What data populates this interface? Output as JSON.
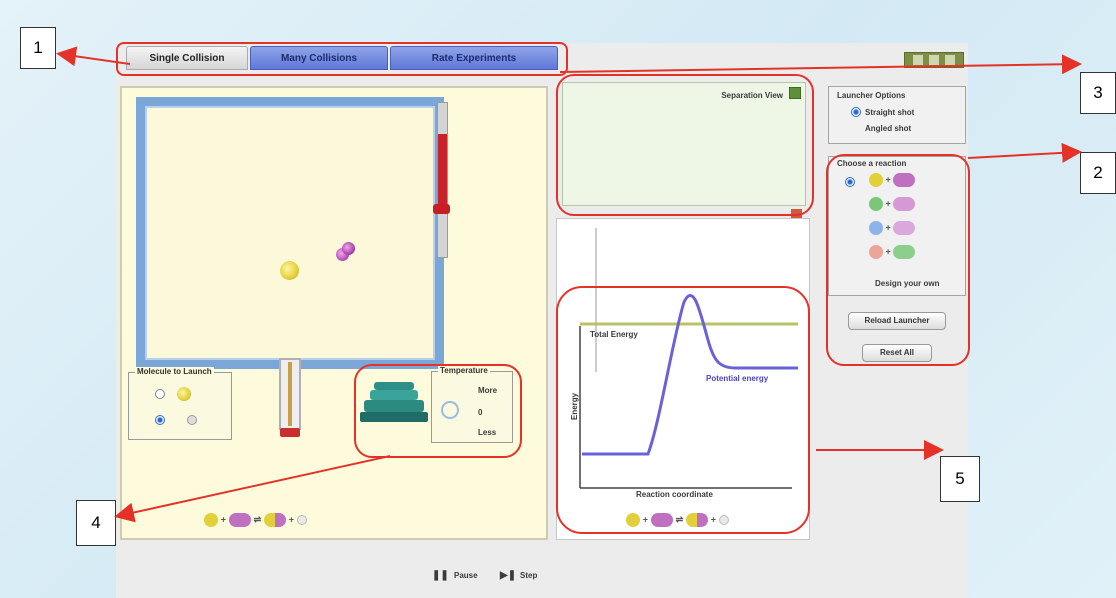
{
  "tabs": [
    {
      "label": "Single Collision",
      "active": true
    },
    {
      "label": "Many Collisions",
      "active": false
    },
    {
      "label": "Rate Experiments",
      "active": false
    }
  ],
  "amount_panel": {
    "title": "Molecule to Launch"
  },
  "temperature_panel": {
    "title": "Temperature",
    "options": [
      "More",
      "0",
      "Less"
    ]
  },
  "separation_view": {
    "label": "Separation View"
  },
  "energy_chart": {
    "ylabel": "Energy",
    "xlabel": "Reaction coordinate",
    "total_energy_label": "Total Energy",
    "potential_energy_label": "Potential energy"
  },
  "launcher_options": {
    "title": "Launcher Options",
    "options": [
      {
        "label": "Straight shot",
        "selected": true
      },
      {
        "label": "Angled shot",
        "selected": false
      }
    ]
  },
  "reaction_chooser": {
    "title": "Choose a reaction",
    "design_label": "Design your own",
    "reactions": [
      {
        "a": "#e8d84a",
        "b": "#b65ab8",
        "selected": true
      },
      {
        "a": "#6cc16c",
        "b": "#b65ab8",
        "selected": false
      },
      {
        "a": "#7da8e6",
        "b": "#b65ab8",
        "selected": false
      },
      {
        "a": "#e89a8a",
        "b": "#6cc16c",
        "selected": false
      }
    ]
  },
  "buttons": {
    "reload_launcher": "Reload Launcher",
    "reset_all": "Reset All"
  },
  "clock": {
    "pause": "Pause",
    "step": "Step"
  },
  "callouts": {
    "c1": "1",
    "c2": "2",
    "c3": "3",
    "c4": "4",
    "c5": "5"
  },
  "colors": {
    "annotation_red": "#e53228",
    "tab_blue": "#6b83dc",
    "box_blue": "#7ba6d8",
    "energy_line": "#6a62d8",
    "total_energy_line": "#b9c266"
  }
}
